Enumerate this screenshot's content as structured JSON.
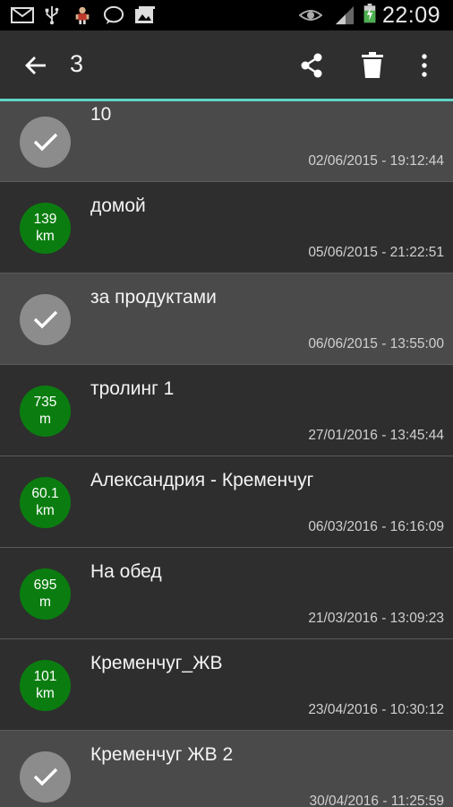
{
  "status_bar": {
    "time": "22:09",
    "icons": [
      "mail-icon",
      "usb-icon",
      "app-figure-icon",
      "chat-bubble-icon",
      "photo-icon",
      "eye-icon",
      "signal-icon",
      "battery-charging-icon"
    ]
  },
  "app_bar": {
    "title": "3",
    "icons": [
      "back-arrow-icon",
      "share-icon",
      "delete-icon",
      "overflow-menu-icon"
    ],
    "accent_color": "#5fd4c4"
  },
  "colors": {
    "selected_row": "#4a4a4a",
    "unselected_row": "#2e2e2e",
    "distance_badge": "#0b7d10",
    "check_badge": "#8c8c8c"
  },
  "tracks": [
    {
      "selected": true,
      "badge_line1": "",
      "badge_line2": "",
      "name": "10",
      "date": "02/06/2015 - 19:12:44"
    },
    {
      "selected": false,
      "badge_line1": "139",
      "badge_line2": "km",
      "name": "домой",
      "date": "05/06/2015 - 21:22:51"
    },
    {
      "selected": true,
      "badge_line1": "",
      "badge_line2": "",
      "name": "за продуктами",
      "date": "06/06/2015 - 13:55:00"
    },
    {
      "selected": false,
      "badge_line1": "735",
      "badge_line2": "m",
      "name": "тролинг 1",
      "date": "27/01/2016 - 13:45:44"
    },
    {
      "selected": false,
      "badge_line1": "60.1",
      "badge_line2": "km",
      "name": "Александрия - Кременчуг",
      "date": "06/03/2016 - 16:16:09"
    },
    {
      "selected": false,
      "badge_line1": "695",
      "badge_line2": "m",
      "name": "На обед",
      "date": "21/03/2016 - 13:09:23"
    },
    {
      "selected": false,
      "badge_line1": "101",
      "badge_line2": "km",
      "name": "Кременчуг_ЖВ",
      "date": "23/04/2016 - 10:30:12"
    },
    {
      "selected": true,
      "badge_line1": "",
      "badge_line2": "",
      "name": "Кременчуг ЖВ 2",
      "date": "30/04/2016 - 11:25:59"
    }
  ]
}
